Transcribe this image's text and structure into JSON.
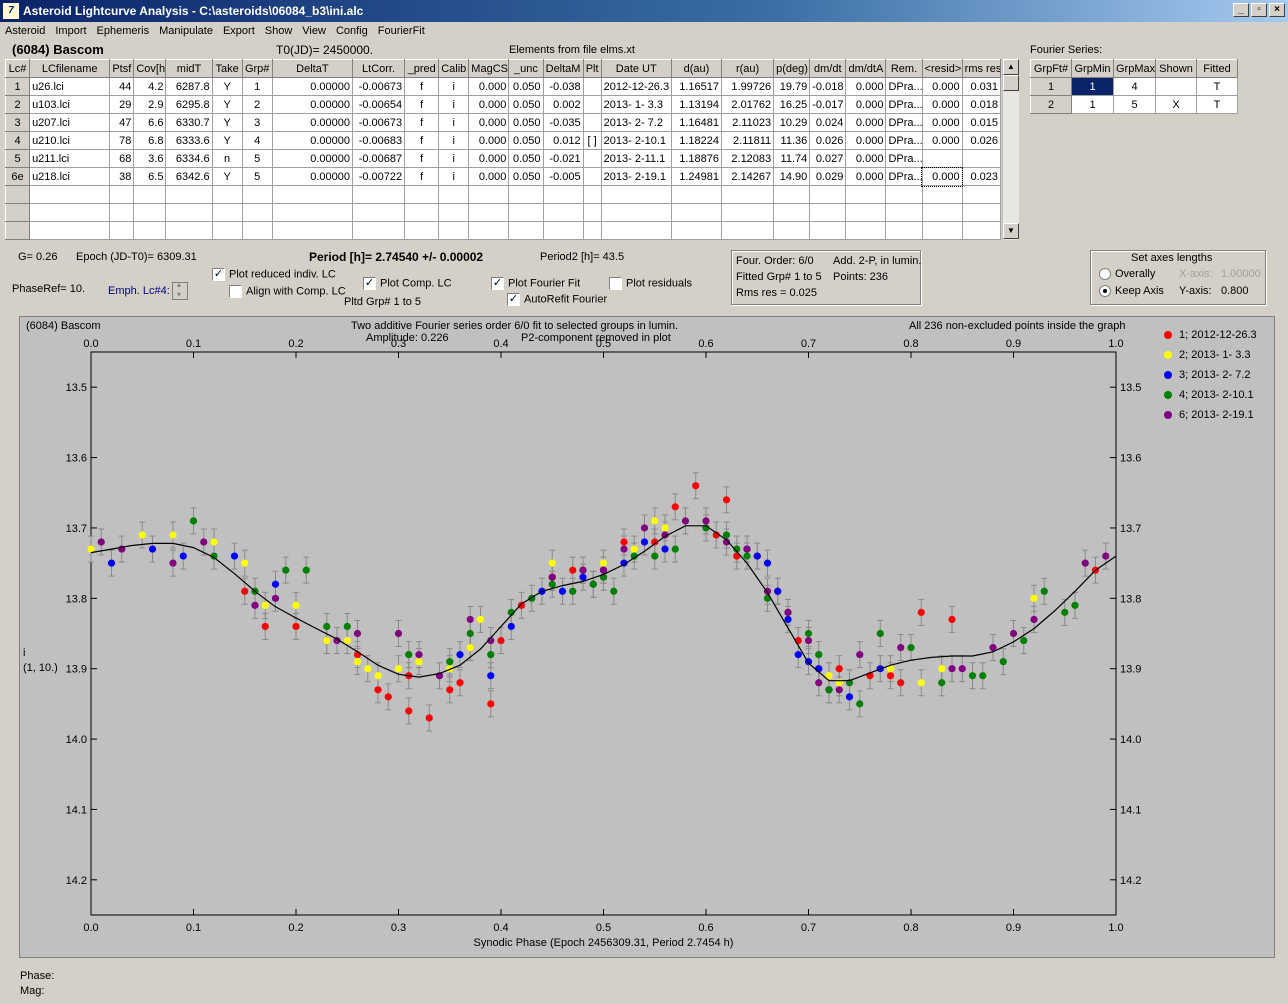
{
  "window": {
    "title": "Asteroid Lightcurve Analysis - C:\\asteroids\\06084_b3\\ini.alc",
    "icon_glyph": "7",
    "min": "_",
    "max": "▫",
    "close": "×"
  },
  "menu": [
    "Asteroid",
    "Import",
    "Ephemeris",
    "Manipulate",
    "Export",
    "Show",
    "View",
    "Config",
    "FourierFit"
  ],
  "header": {
    "asteroid": "(6084) Bascom",
    "t0": "T0(JD)= 2450000.",
    "elements": "Elements from file elms.xt"
  },
  "lc_table": {
    "columns": [
      "Lc#",
      "LCfilename",
      "Ptsf",
      "Cov[h]",
      "midT",
      "Take",
      "Grp#",
      "DeltaT",
      "LtCorr.",
      "_pred",
      "Calib",
      "MagCS",
      "_unc",
      "DeltaM",
      "Plt",
      "Date UT",
      "d(au)",
      "r(au)",
      "p(deg)",
      "dm/dt",
      "dm/dtA",
      "Rem.",
      "<resid>",
      "rms res"
    ],
    "rows": [
      [
        "1",
        "u26.lci",
        "44",
        "4.2",
        "6287.8",
        "Y",
        "1",
        "0.00000",
        "-0.00673",
        "f",
        "i",
        "0.000",
        "0.050",
        "-0.038",
        "",
        "2012-12-26.3",
        "1.16517",
        "1.99726",
        "19.79",
        "-0.018",
        "0.000",
        "DPra...",
        "0.000",
        "0.031"
      ],
      [
        "2",
        "u103.lci",
        "29",
        "2.9",
        "6295.8",
        "Y",
        "2",
        "0.00000",
        "-0.00654",
        "f",
        "i",
        "0.000",
        "0.050",
        "0.002",
        "",
        "2013- 1- 3.3",
        "1.13194",
        "2.01762",
        "16.25",
        "-0.017",
        "0.000",
        "DPra...",
        "0.000",
        "0.018"
      ],
      [
        "3",
        "u207.lci",
        "47",
        "6.6",
        "6330.7",
        "Y",
        "3",
        "0.00000",
        "-0.00673",
        "f",
        "i",
        "0.000",
        "0.050",
        "-0.035",
        "",
        "2013- 2- 7.2",
        "1.16481",
        "2.11023",
        "10.29",
        "0.024",
        "0.000",
        "DPra...",
        "0.000",
        "0.015"
      ],
      [
        "4",
        "u210.lci",
        "78",
        "6.8",
        "6333.6",
        "Y",
        "4",
        "0.00000",
        "-0.00683",
        "f",
        "i",
        "0.000",
        "0.050",
        "0.012",
        "[ ]",
        "2013- 2-10.1",
        "1.18224",
        "2.11811",
        "11.36",
        "0.026",
        "0.000",
        "DPra...",
        "0.000",
        "0.026"
      ],
      [
        "5",
        "u211.lci",
        "68",
        "3.6",
        "6334.6",
        "n",
        "5",
        "0.00000",
        "-0.00687",
        "f",
        "i",
        "0.000",
        "0.050",
        "-0.021",
        "",
        "2013- 2-11.1",
        "1.18876",
        "2.12083",
        "11.74",
        "0.027",
        "0.000",
        "DPra...",
        "",
        ""
      ],
      [
        "6e",
        "u218.lci",
        "38",
        "6.5",
        "6342.6",
        "Y",
        "5",
        "0.00000",
        "-0.00722",
        "f",
        "i",
        "0.000",
        "0.050",
        "-0.005",
        "",
        "2013- 2-19.1",
        "1.24981",
        "2.14267",
        "14.90",
        "0.029",
        "0.000",
        "DPra...",
        "0.000",
        "0.023"
      ]
    ]
  },
  "fourier_table": {
    "title": "Fourier Series:",
    "columns": [
      "GrpFt#",
      "GrpMin",
      "GrpMax",
      "Shown",
      "Fitted"
    ],
    "rows": [
      [
        "1",
        "1",
        "4",
        "",
        "T"
      ],
      [
        "2",
        "1",
        "5",
        "X",
        "T"
      ]
    ]
  },
  "info": {
    "g": "G= 0.26",
    "epoch": "Epoch (JD-T0)= 6309.31",
    "period": "Period [h]= 2.74540 +/- 0.00002",
    "period2": "Period2 [h]= 43.5",
    "phase_ref": "PhaseRef= 10.",
    "emph": "Emph. Lc#4:",
    "plot_reduced": "Plot reduced indiv. LC",
    "align_comp": "Align with Comp. LC",
    "plot_comp": "Plot Comp. LC",
    "plotted_grp": "Pltd Grp#  1   to   5",
    "plot_fourier": "Plot Fourier Fit",
    "autorefit": "AutoRefit Fourier",
    "plot_residuals": "Plot residuals"
  },
  "fit_summary": {
    "order": "Four. Order:  6/0",
    "add": "Add. 2-P, in lumin.",
    "fitted": "Fitted Grp# 1 to 5",
    "points": "Points: 236",
    "rms": "Rms res     = 0.025"
  },
  "axes_box": {
    "title": "Set axes lengths",
    "overall": "Overally",
    "keep": "Keep Axis",
    "x_label": "X-axis:",
    "x_val": "1.00000",
    "y_label": "Y-axis:",
    "y_val": "0.800"
  },
  "plot_text": {
    "name": "(6084) Bascom",
    "desc1": "Two additive Fourier series order 6/0 fit to selected groups in lumin.",
    "desc2": "Amplitude: 0.226",
    "desc3": "P2-component removed in plot",
    "inside": "All 236 non-excluded points inside the graph",
    "ylabel1": "i",
    "ylabel2": "(1, 10.)"
  },
  "status": {
    "phase": "Phase:",
    "mag": "Mag:"
  },
  "chart_data": {
    "type": "scatter",
    "xlabel": "Synodic Phase (Epoch 2456309.31, Period 2.7454 h)",
    "xlim": [
      0.0,
      1.0
    ],
    "ylim": [
      13.45,
      14.25
    ],
    "y_inverted": true,
    "x_ticks": [
      "0.0",
      "0.1",
      "0.2",
      "0.3",
      "0.4",
      "0.5",
      "0.6",
      "0.7",
      "0.8",
      "0.9",
      "1.0"
    ],
    "y_ticks": [
      "13.5",
      "13.6",
      "13.7",
      "13.8",
      "13.9",
      "14.0",
      "14.1",
      "14.2"
    ],
    "series": [
      {
        "name": "1; 2012-12-26.3",
        "color": "#ff0000",
        "points": [
          [
            0.15,
            13.79
          ],
          [
            0.17,
            13.84
          ],
          [
            0.2,
            13.84
          ],
          [
            0.23,
            13.86
          ],
          [
            0.26,
            13.88
          ],
          [
            0.28,
            13.93
          ],
          [
            0.29,
            13.94
          ],
          [
            0.31,
            13.91
          ],
          [
            0.31,
            13.96
          ],
          [
            0.33,
            13.97
          ],
          [
            0.35,
            13.93
          ],
          [
            0.36,
            13.92
          ],
          [
            0.37,
            13.87
          ],
          [
            0.39,
            13.95
          ],
          [
            0.4,
            13.86
          ],
          [
            0.42,
            13.81
          ],
          [
            0.45,
            13.77
          ],
          [
            0.47,
            13.76
          ],
          [
            0.48,
            13.76
          ],
          [
            0.5,
            13.77
          ],
          [
            0.52,
            13.72
          ],
          [
            0.55,
            13.72
          ],
          [
            0.57,
            13.67
          ],
          [
            0.59,
            13.64
          ],
          [
            0.61,
            13.71
          ],
          [
            0.62,
            13.66
          ],
          [
            0.63,
            13.74
          ],
          [
            0.65,
            13.74
          ],
          [
            0.67,
            13.79
          ],
          [
            0.69,
            13.86
          ],
          [
            0.71,
            13.9
          ],
          [
            0.73,
            13.9
          ],
          [
            0.76,
            13.91
          ],
          [
            0.78,
            13.91
          ],
          [
            0.79,
            13.92
          ],
          [
            0.81,
            13.82
          ],
          [
            0.84,
            13.83
          ],
          [
            0.98,
            13.76
          ]
        ]
      },
      {
        "name": "2; 2013- 1- 3.3",
        "color": "#ffff00",
        "points": [
          [
            0.0,
            13.73
          ],
          [
            0.05,
            13.71
          ],
          [
            0.08,
            13.71
          ],
          [
            0.12,
            13.72
          ],
          [
            0.15,
            13.75
          ],
          [
            0.17,
            13.81
          ],
          [
            0.2,
            13.81
          ],
          [
            0.23,
            13.86
          ],
          [
            0.25,
            13.86
          ],
          [
            0.26,
            13.89
          ],
          [
            0.27,
            13.9
          ],
          [
            0.28,
            13.91
          ],
          [
            0.3,
            13.9
          ],
          [
            0.32,
            13.89
          ],
          [
            0.35,
            13.9
          ],
          [
            0.37,
            13.87
          ],
          [
            0.38,
            13.83
          ],
          [
            0.45,
            13.75
          ],
          [
            0.5,
            13.75
          ],
          [
            0.53,
            13.73
          ],
          [
            0.55,
            13.69
          ],
          [
            0.56,
            13.7
          ],
          [
            0.58,
            13.69
          ],
          [
            0.6,
            13.69
          ],
          [
            0.72,
            13.91
          ],
          [
            0.73,
            13.92
          ],
          [
            0.78,
            13.9
          ],
          [
            0.81,
            13.92
          ],
          [
            0.83,
            13.9
          ],
          [
            0.92,
            13.8
          ]
        ]
      },
      {
        "name": "3; 2013- 2- 7.2",
        "color": "#0000ff",
        "points": [
          [
            0.02,
            13.75
          ],
          [
            0.06,
            13.73
          ],
          [
            0.09,
            13.74
          ],
          [
            0.14,
            13.74
          ],
          [
            0.18,
            13.78
          ],
          [
            0.36,
            13.88
          ],
          [
            0.39,
            13.91
          ],
          [
            0.41,
            13.84
          ],
          [
            0.44,
            13.79
          ],
          [
            0.46,
            13.79
          ],
          [
            0.48,
            13.77
          ],
          [
            0.49,
            13.78
          ],
          [
            0.5,
            13.76
          ],
          [
            0.52,
            13.75
          ],
          [
            0.54,
            13.72
          ],
          [
            0.56,
            13.73
          ],
          [
            0.64,
            13.73
          ],
          [
            0.65,
            13.74
          ],
          [
            0.66,
            13.75
          ],
          [
            0.67,
            13.79
          ],
          [
            0.68,
            13.83
          ],
          [
            0.69,
            13.88
          ],
          [
            0.7,
            13.89
          ],
          [
            0.71,
            13.9
          ],
          [
            0.72,
            13.93
          ],
          [
            0.74,
            13.94
          ],
          [
            0.77,
            13.9
          ]
        ]
      },
      {
        "name": "4; 2013- 2-10.1",
        "color": "#008000",
        "points": [
          [
            0.1,
            13.69
          ],
          [
            0.12,
            13.74
          ],
          [
            0.16,
            13.79
          ],
          [
            0.19,
            13.76
          ],
          [
            0.21,
            13.76
          ],
          [
            0.23,
            13.84
          ],
          [
            0.25,
            13.84
          ],
          [
            0.31,
            13.88
          ],
          [
            0.35,
            13.89
          ],
          [
            0.37,
            13.85
          ],
          [
            0.39,
            13.88
          ],
          [
            0.41,
            13.82
          ],
          [
            0.43,
            13.8
          ],
          [
            0.45,
            13.78
          ],
          [
            0.47,
            13.79
          ],
          [
            0.49,
            13.78
          ],
          [
            0.5,
            13.77
          ],
          [
            0.51,
            13.79
          ],
          [
            0.53,
            13.74
          ],
          [
            0.55,
            13.74
          ],
          [
            0.57,
            13.73
          ],
          [
            0.6,
            13.7
          ],
          [
            0.62,
            13.71
          ],
          [
            0.63,
            13.73
          ],
          [
            0.64,
            13.74
          ],
          [
            0.66,
            13.8
          ],
          [
            0.68,
            13.82
          ],
          [
            0.7,
            13.85
          ],
          [
            0.71,
            13.88
          ],
          [
            0.72,
            13.93
          ],
          [
            0.74,
            13.92
          ],
          [
            0.75,
            13.95
          ],
          [
            0.77,
            13.85
          ],
          [
            0.8,
            13.87
          ],
          [
            0.83,
            13.92
          ],
          [
            0.86,
            13.91
          ],
          [
            0.87,
            13.91
          ],
          [
            0.89,
            13.89
          ],
          [
            0.91,
            13.86
          ],
          [
            0.93,
            13.79
          ],
          [
            0.95,
            13.82
          ],
          [
            0.96,
            13.81
          ]
        ]
      },
      {
        "name": "6; 2013- 2-19.1",
        "color": "#800080",
        "points": [
          [
            0.01,
            13.72
          ],
          [
            0.03,
            13.73
          ],
          [
            0.08,
            13.75
          ],
          [
            0.11,
            13.72
          ],
          [
            0.16,
            13.81
          ],
          [
            0.18,
            13.8
          ],
          [
            0.24,
            13.86
          ],
          [
            0.26,
            13.85
          ],
          [
            0.3,
            13.85
          ],
          [
            0.32,
            13.88
          ],
          [
            0.34,
            13.91
          ],
          [
            0.37,
            13.83
          ],
          [
            0.39,
            13.86
          ],
          [
            0.45,
            13.77
          ],
          [
            0.48,
            13.76
          ],
          [
            0.5,
            13.76
          ],
          [
            0.52,
            13.73
          ],
          [
            0.54,
            13.7
          ],
          [
            0.56,
            13.71
          ],
          [
            0.58,
            13.69
          ],
          [
            0.6,
            13.69
          ],
          [
            0.62,
            13.72
          ],
          [
            0.64,
            13.73
          ],
          [
            0.66,
            13.79
          ],
          [
            0.68,
            13.82
          ],
          [
            0.7,
            13.86
          ],
          [
            0.71,
            13.92
          ],
          [
            0.73,
            13.93
          ],
          [
            0.75,
            13.88
          ],
          [
            0.79,
            13.87
          ],
          [
            0.84,
            13.9
          ],
          [
            0.85,
            13.9
          ],
          [
            0.88,
            13.87
          ],
          [
            0.9,
            13.85
          ],
          [
            0.92,
            13.83
          ],
          [
            0.97,
            13.75
          ],
          [
            0.99,
            13.74
          ]
        ]
      }
    ],
    "fit_curve": [
      [
        0.0,
        13.735
      ],
      [
        0.02,
        13.73
      ],
      [
        0.04,
        13.725
      ],
      [
        0.06,
        13.722
      ],
      [
        0.08,
        13.722
      ],
      [
        0.1,
        13.728
      ],
      [
        0.12,
        13.742
      ],
      [
        0.14,
        13.765
      ],
      [
        0.16,
        13.79
      ],
      [
        0.18,
        13.812
      ],
      [
        0.2,
        13.828
      ],
      [
        0.22,
        13.843
      ],
      [
        0.24,
        13.858
      ],
      [
        0.26,
        13.876
      ],
      [
        0.28,
        13.895
      ],
      [
        0.3,
        13.908
      ],
      [
        0.32,
        13.912
      ],
      [
        0.34,
        13.907
      ],
      [
        0.36,
        13.895
      ],
      [
        0.38,
        13.872
      ],
      [
        0.4,
        13.84
      ],
      [
        0.42,
        13.808
      ],
      [
        0.44,
        13.79
      ],
      [
        0.46,
        13.782
      ],
      [
        0.48,
        13.776
      ],
      [
        0.5,
        13.766
      ],
      [
        0.52,
        13.752
      ],
      [
        0.54,
        13.733
      ],
      [
        0.56,
        13.712
      ],
      [
        0.58,
        13.697
      ],
      [
        0.6,
        13.697
      ],
      [
        0.62,
        13.717
      ],
      [
        0.64,
        13.75
      ],
      [
        0.66,
        13.792
      ],
      [
        0.68,
        13.842
      ],
      [
        0.7,
        13.892
      ],
      [
        0.72,
        13.917
      ],
      [
        0.74,
        13.917
      ],
      [
        0.76,
        13.906
      ],
      [
        0.78,
        13.895
      ],
      [
        0.8,
        13.888
      ],
      [
        0.82,
        13.884
      ],
      [
        0.84,
        13.882
      ],
      [
        0.86,
        13.882
      ],
      [
        0.88,
        13.876
      ],
      [
        0.9,
        13.862
      ],
      [
        0.92,
        13.843
      ],
      [
        0.94,
        13.818
      ],
      [
        0.96,
        13.79
      ],
      [
        0.98,
        13.76
      ],
      [
        1.0,
        13.74
      ]
    ]
  }
}
